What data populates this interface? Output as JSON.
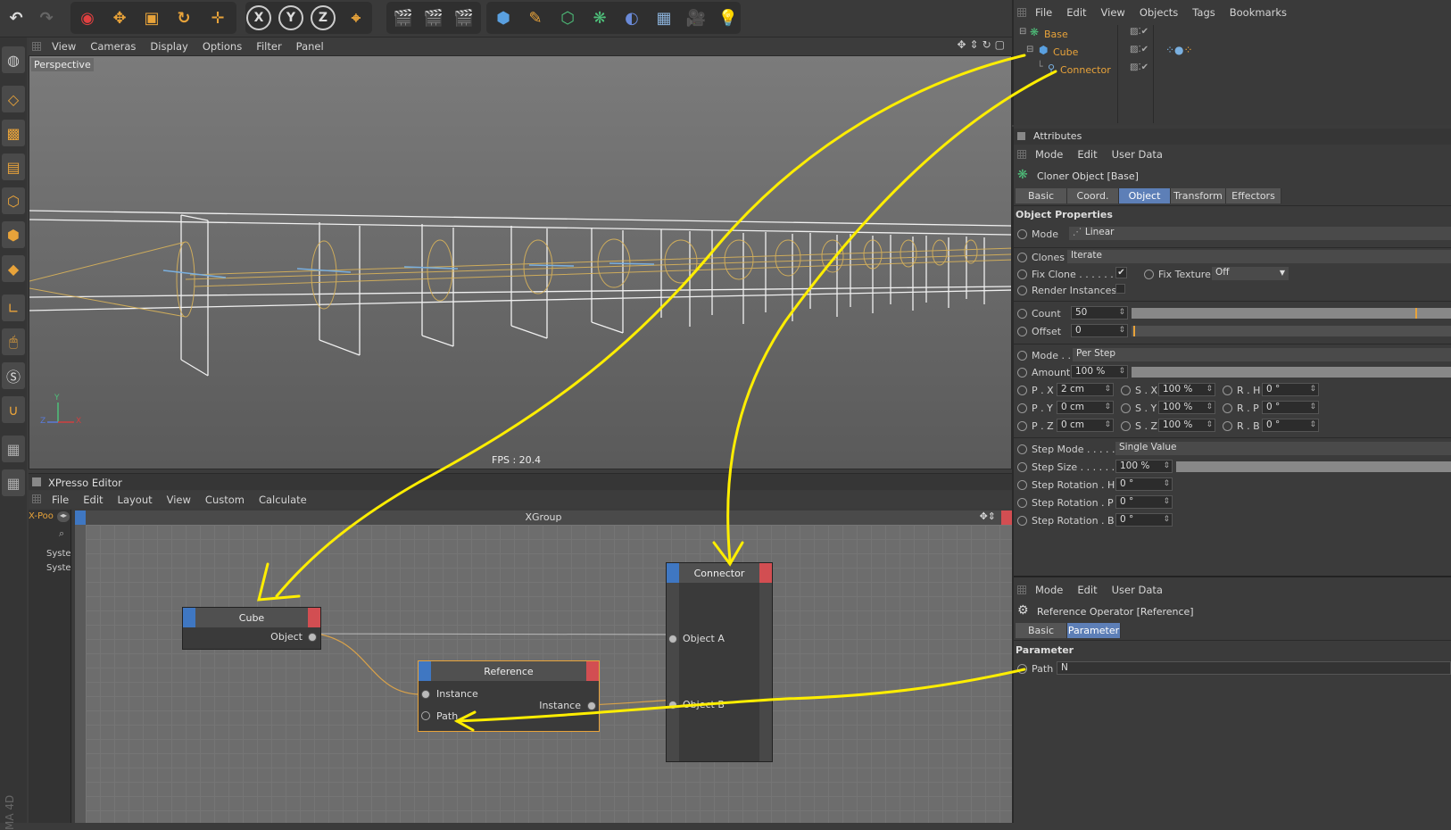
{
  "toolbar": {
    "tools": [
      "undo",
      "redo",
      "select",
      "move",
      "scale",
      "rotate",
      "add",
      "X",
      "Y",
      "Z",
      "world",
      "render-view",
      "render",
      "render-settings",
      "cube",
      "pen",
      "subdivision",
      "mograph",
      "deformer",
      "floor",
      "camera",
      "light"
    ]
  },
  "viewport": {
    "menu": [
      "View",
      "Cameras",
      "Display",
      "Options",
      "Filter",
      "Panel"
    ],
    "label": "Perspective",
    "fps": "FPS : 20.4",
    "axis": {
      "y": "Y",
      "z": "Z",
      "x": "X"
    }
  },
  "objects": {
    "menu": [
      "File",
      "Edit",
      "View",
      "Objects",
      "Tags",
      "Bookmarks"
    ],
    "items": [
      {
        "name": "Base",
        "color": "#e8a33a"
      },
      {
        "name": "Cube",
        "color": "#e8a33a"
      },
      {
        "name": "Connector",
        "color": "#e8a33a"
      }
    ]
  },
  "attributes": {
    "title": "Attributes",
    "menu": [
      "Mode",
      "Edit",
      "User Data"
    ],
    "object_title": "Cloner Object [Base]",
    "tabs": [
      "Basic",
      "Coord.",
      "Object",
      "Transform",
      "Effectors"
    ],
    "active_tab": "Object",
    "section": "Object Properties",
    "mode_label": "Mode",
    "mode_value": "Linear",
    "clones_label": "Clones",
    "clones_value": "Iterate",
    "fixclone_label": "Fix Clone . . . . . .",
    "fixclone_check": "✔",
    "fixtexture_label": "Fix Texture",
    "fixtexture_value": "Off",
    "render_label": "Render Instances",
    "count_label": "Count",
    "count_value": "50",
    "offset_label": "Offset",
    "offset_value": "0",
    "mode2_label": "Mode . .",
    "mode2_value": "Per Step",
    "amount_label": "Amount",
    "amount_value": "100 %",
    "px_label": "P . X",
    "px": "2 cm",
    "sx_label": "S . X",
    "sx": "100 %",
    "rh_label": "R . H",
    "rh": "0 °",
    "py_label": "P . Y",
    "py": "0 cm",
    "sy_label": "S . Y",
    "sy": "100 %",
    "rp_label": "R . P",
    "rp": "0 °",
    "pz_label": "P . Z",
    "pz": "0 cm",
    "sz_label": "S . Z",
    "sz": "100 %",
    "rb_label": "R . B",
    "rb": "0 °",
    "stepmode_label": "Step Mode . . . . .",
    "stepmode_value": "Single Value",
    "stepsize_label": "Step Size . . . . . .",
    "stepsize_value": "100 %",
    "steph_label": "Step Rotation . H",
    "steph": "0 °",
    "stepp_label": "Step Rotation . P",
    "stepp": "0 °",
    "stepb_label": "Step Rotation . B",
    "stepb": "0 °"
  },
  "ref": {
    "menu": [
      "Mode",
      "Edit",
      "User Data"
    ],
    "title": "Reference Operator [Reference]",
    "tabs": [
      "Basic",
      "Parameter"
    ],
    "active_tab": "Parameter",
    "section": "Parameter",
    "path_label": "Path",
    "path_value": "N"
  },
  "xpresso": {
    "title": "XPresso Editor",
    "menu": [
      "File",
      "Edit",
      "Layout",
      "View",
      "Custom",
      "Calculate"
    ],
    "group": "XGroup",
    "pool": "X-Poo",
    "tree": [
      "Syste",
      "Syste"
    ],
    "nodes": {
      "cube": {
        "title": "Cube",
        "port": "Object"
      },
      "reference": {
        "title": "Reference",
        "in1": "Instance",
        "in2": "Path",
        "out": "Instance"
      },
      "connector": {
        "title": "Connector",
        "a": "Object A",
        "b": "Object B"
      }
    }
  },
  "brand": "MA 4D"
}
